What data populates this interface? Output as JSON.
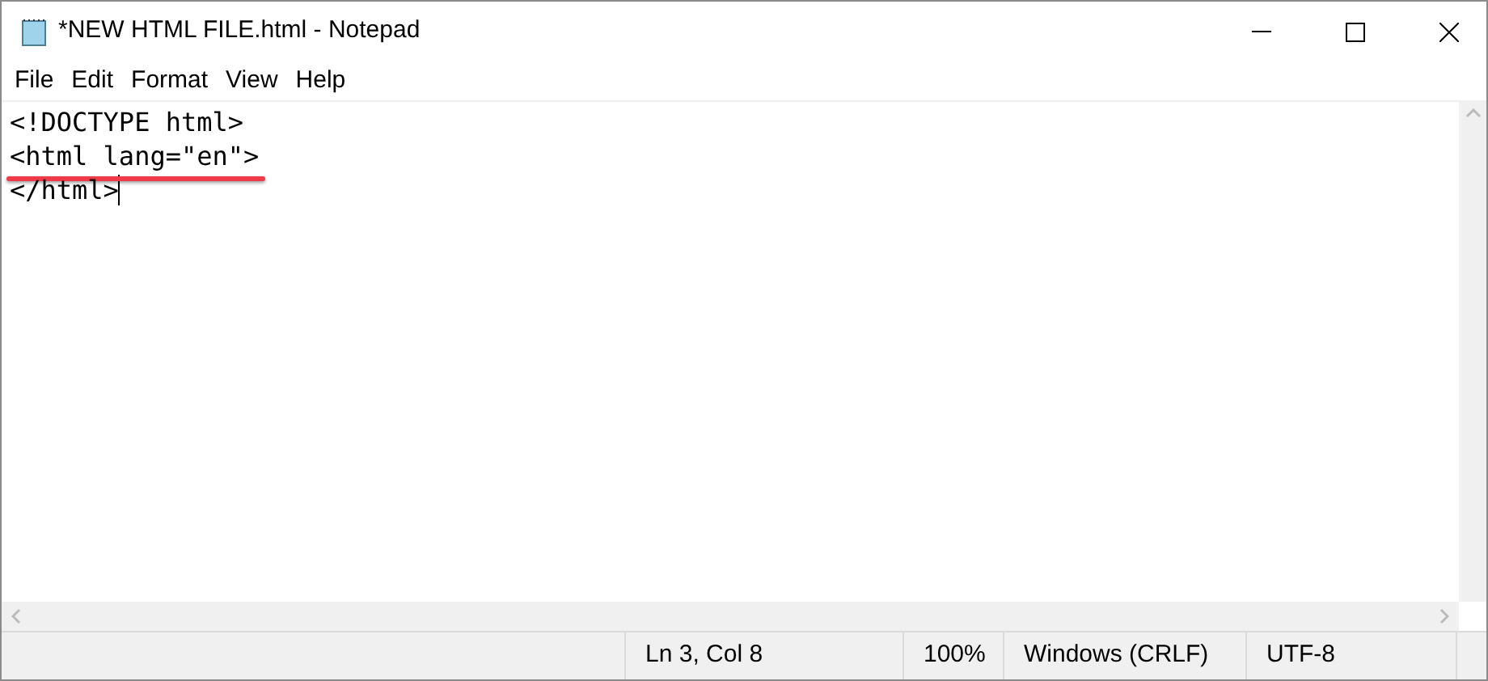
{
  "window": {
    "title": "*NEW HTML FILE.html - Notepad"
  },
  "menu": [
    "File",
    "Edit",
    "Format",
    "View",
    "Help"
  ],
  "editor": {
    "lines": [
      {
        "text": "<!DOCTYPE html>",
        "highlighted": false,
        "caret": false
      },
      {
        "text": "<html lang=\"en\">",
        "highlighted": true,
        "caret": false
      },
      {
        "text": "</html>",
        "highlighted": false,
        "caret": true
      }
    ]
  },
  "status_bar": [
    "Ln 3, Col 8",
    "100%",
    "Windows (CRLF)",
    "UTF-8"
  ]
}
